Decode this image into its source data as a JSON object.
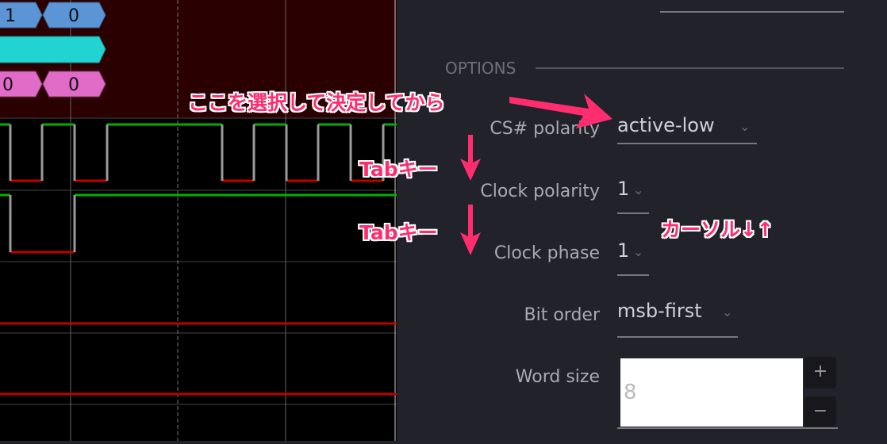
{
  "waveform": {
    "decoder_rows": [
      {
        "values": [
          "1",
          "0"
        ],
        "color": "#5b95d6"
      },
      {
        "values": [],
        "color": "#22d3d3"
      },
      {
        "values": [
          "0",
          "0"
        ],
        "color": "#e06cc8"
      }
    ],
    "colors": {
      "high": "#00b000",
      "low": "#c00000",
      "edge": "#9a9a9a",
      "decoder_bg": "#2a0000"
    }
  },
  "options": {
    "section_title": "OPTIONS",
    "fields": [
      {
        "label": "CS# polarity",
        "value": "active-low"
      },
      {
        "label": "Clock polarity",
        "value": "1"
      },
      {
        "label": "Clock phase",
        "value": "1"
      },
      {
        "label": "Bit order",
        "value": "msb-first"
      },
      {
        "label": "Word size",
        "value": "8"
      }
    ],
    "increment_label": "+",
    "decrement_label": "−"
  },
  "annotations": {
    "select_note": "ここを選択して決定してから",
    "tab_key_1": "Tabキー",
    "tab_key_2": "Tabキー",
    "cursor_note": "カーソル↓↑",
    "color": "#ff2d6f"
  }
}
